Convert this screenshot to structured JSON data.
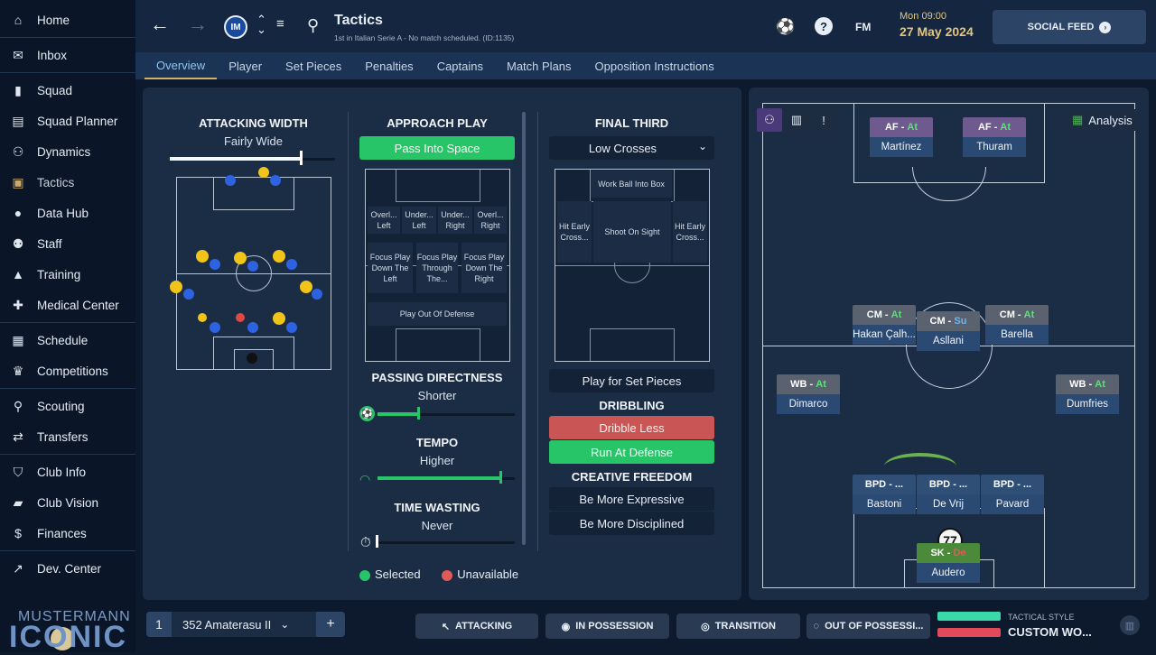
{
  "sidebar": {
    "items": [
      {
        "label": "Home",
        "icon": "home-icon"
      },
      {
        "label": "Inbox",
        "icon": "inbox-icon"
      },
      {
        "label": "Squad",
        "icon": "shirt-icon"
      },
      {
        "label": "Squad Planner",
        "icon": "clipboard-icon"
      },
      {
        "label": "Dynamics",
        "icon": "dynamics-icon"
      },
      {
        "label": "Tactics",
        "icon": "tactics-icon"
      },
      {
        "label": "Data Hub",
        "icon": "datahub-icon"
      },
      {
        "label": "Staff",
        "icon": "staff-icon"
      },
      {
        "label": "Training",
        "icon": "training-icon"
      },
      {
        "label": "Medical Center",
        "icon": "medical-icon"
      },
      {
        "label": "Schedule",
        "icon": "calendar-icon"
      },
      {
        "label": "Competitions",
        "icon": "trophy-icon"
      },
      {
        "label": "Scouting",
        "icon": "search-icon"
      },
      {
        "label": "Transfers",
        "icon": "transfer-icon"
      },
      {
        "label": "Club Info",
        "icon": "shield-icon"
      },
      {
        "label": "Club Vision",
        "icon": "briefcase-icon"
      },
      {
        "label": "Finances",
        "icon": "money-icon"
      },
      {
        "label": "Dev. Center",
        "icon": "trend-icon"
      }
    ],
    "brand_top": "MUSTERMANN",
    "brand_bottom": "ICONIC"
  },
  "header": {
    "title": "Tactics",
    "subtitle": "1st in Italian Serie A - No match scheduled. (ID:1135)",
    "crest": "IM",
    "time": "Mon 09:00",
    "date": "27 May 2024",
    "fm_label": "FM",
    "social_label": "SOCIAL FEED"
  },
  "tabs": [
    "Overview",
    "Player",
    "Set Pieces",
    "Penalties",
    "Captains",
    "Match Plans",
    "Opposition Instructions"
  ],
  "attacking_width": {
    "heading": "ATTACKING WIDTH",
    "value": "Fairly Wide",
    "level": 0.8
  },
  "approach_play": {
    "heading": "APPROACH PLAY",
    "selected": "Pass Into Space",
    "zones": [
      "Overl... Left",
      "Under... Left",
      "Under... Right",
      "Overl... Right",
      "Focus Play Down The Left",
      "Focus Play Through The...",
      "Focus Play Down The Right",
      "Play Out Of Defense"
    ]
  },
  "passing": {
    "heading": "PASSING DIRECTNESS",
    "value": "Shorter",
    "level": 0.3
  },
  "tempo": {
    "heading": "TEMPO",
    "value": "Higher",
    "level": 0.9
  },
  "time_wasting": {
    "heading": "TIME WASTING",
    "value": "Never",
    "level": 0.0
  },
  "final_third": {
    "heading": "FINAL THIRD",
    "select": "Low Crosses",
    "zones": [
      "Work Ball Into Box",
      "Hit Early Cross...",
      "Shoot On Sight",
      "Hit Early Cross..."
    ],
    "set_pieces": "Play for Set Pieces"
  },
  "dribbling": {
    "heading": "DRIBBLING",
    "option1": "Dribble Less",
    "option2": "Run At Defense"
  },
  "creative": {
    "heading": "CREATIVE FREEDOM",
    "option1": "Be More Expressive",
    "option2": "Be More Disciplined"
  },
  "legend": {
    "selected": "Selected",
    "unavailable": "Unavailable"
  },
  "analysis_label": "Analysis",
  "players": [
    {
      "role": "AF",
      "duty": "At",
      "name": "Martínez",
      "color": "#6e5a8e"
    },
    {
      "role": "AF",
      "duty": "At",
      "name": "Thuram",
      "color": "#6e5a8e"
    },
    {
      "role": "CM",
      "duty": "At",
      "name": "Hakan Çalh...",
      "color": "#5a6270"
    },
    {
      "role": "CM",
      "duty": "Su",
      "name": "Asllani",
      "color": "#5a6270"
    },
    {
      "role": "CM",
      "duty": "At",
      "name": "Barella",
      "color": "#5a6270"
    },
    {
      "role": "WB",
      "duty": "At",
      "name": "Dimarco",
      "color": "#5a6270"
    },
    {
      "role": "WB",
      "duty": "At",
      "name": "Dumfries",
      "color": "#5a6270"
    },
    {
      "role": "BPD",
      "duty": "...",
      "name": "Bastoni",
      "color": "#2f4f76"
    },
    {
      "role": "BPD",
      "duty": "...",
      "name": "De Vrij",
      "color": "#2f4f76"
    },
    {
      "role": "BPD",
      "duty": "...",
      "name": "Pavard",
      "color": "#2f4f76"
    },
    {
      "role": "SK",
      "duty": "De",
      "name": "Audero",
      "color": "#4a8a3a"
    }
  ],
  "gk_number": "77",
  "bottom": {
    "slot": "1",
    "tactic_name": "352 Amaterasu II",
    "btn_attacking": "ATTACKING",
    "btn_possession": "IN POSSESSION",
    "btn_transition": "TRANSITION",
    "btn_out": "OUT OF POSSESSI...",
    "style_label": "TACTICAL STYLE",
    "style_value": "CUSTOM WO..."
  },
  "colors": {
    "accent_green": "#27c468",
    "accent_red": "#c95555",
    "gold": "#e3c67f"
  }
}
